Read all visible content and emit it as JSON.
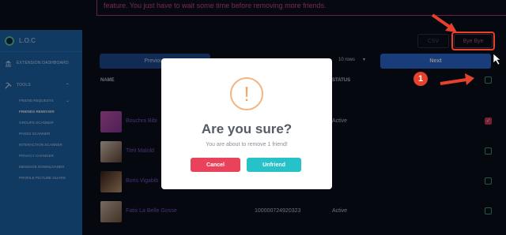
{
  "notice": {
    "text": "feature. You just have to wait some time before removing more friends."
  },
  "sidebar": {
    "brand": "L.O.C",
    "items": [
      {
        "label": "EXTENSION DASHBOARD",
        "icon": "bank-icon"
      },
      {
        "label": "TOOLS",
        "icon": "tools-icon"
      }
    ],
    "sub_items": [
      {
        "label": "FRIEND REQUESTS"
      },
      {
        "label": "FRIENDS REMOVER"
      },
      {
        "label": "GROUPS SCANNER"
      },
      {
        "label": "PAGES SCANNER"
      },
      {
        "label": "INTERACTION SCANNER"
      },
      {
        "label": "PRIVACY CHANGER"
      },
      {
        "label": "MESSAGE DOWNLOADER"
      },
      {
        "label": "PROFILE PICTURE GUARD"
      }
    ]
  },
  "toolbar": {
    "csv_label": "CSV",
    "bye_label": "Bye Bye",
    "prev_label": "Previous",
    "rows_label": "10 rows",
    "next_label": "Next"
  },
  "table": {
    "headers": {
      "name": "NAME",
      "status": "STATUS"
    },
    "rows": [
      {
        "name": "Bouchra Bibi",
        "uid": "",
        "status": "Active",
        "checked": true
      },
      {
        "name": "Titrit Malold",
        "uid": "",
        "status": "",
        "checked": false
      },
      {
        "name": "Boris Vigabib",
        "uid": "",
        "status": "",
        "checked": false
      },
      {
        "name": "Fatix La Belle Gosse",
        "uid": "100000724920323",
        "status": "Active",
        "checked": false
      }
    ]
  },
  "modal": {
    "icon": "!",
    "title": "Are you sure?",
    "message": "You are about to remove 1 friend!",
    "cancel_label": "Cancel",
    "confirm_label": "Unfriend"
  },
  "annotation": {
    "badge": "1",
    "color": "#e5412c"
  },
  "colors": {
    "background": "#0b0f1c",
    "sidebar": "#1f6ab3",
    "accent": "#2f6fe0",
    "danger": "#e8435a",
    "confirm": "#27c2c9",
    "link": "#7e5bd6"
  }
}
